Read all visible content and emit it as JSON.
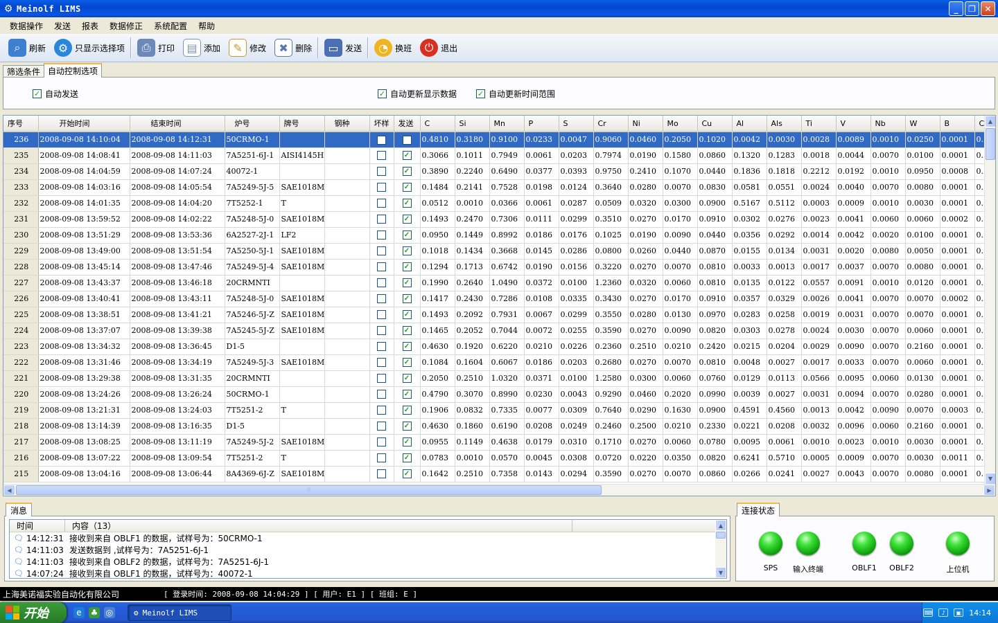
{
  "window": {
    "title": "Meinolf LIMS"
  },
  "menu": [
    "数据操作",
    "发送",
    "报表",
    "数据修正",
    "系统配置",
    "帮助"
  ],
  "toolbar": [
    {
      "label": "刷新",
      "icon": "magnifier-icon",
      "color": "#3f7fd0"
    },
    {
      "label": "只显示选择项",
      "icon": "gear-icon",
      "color": "#2a86d8"
    },
    {
      "label": "打印",
      "icon": "printer-icon",
      "color": "#6c8ab8"
    },
    {
      "label": "添加",
      "icon": "document-add-icon",
      "color": "#7a93c0"
    },
    {
      "label": "修改",
      "icon": "document-edit-icon",
      "color": "#c89a30"
    },
    {
      "label": "删除",
      "icon": "document-delete-icon",
      "color": "#5a78b0"
    },
    {
      "label": "发送",
      "icon": "send-icon",
      "color": "#4a6fb5"
    },
    {
      "label": "换班",
      "icon": "shift-icon",
      "color": "#f0b420"
    },
    {
      "label": "退出",
      "icon": "exit-icon",
      "color": "#d83020"
    }
  ],
  "tabs": [
    "筛选条件",
    "自动控制选项"
  ],
  "options": [
    {
      "label": "自动发送",
      "checked": true
    },
    {
      "label": "自动更新显示数据",
      "checked": true
    },
    {
      "label": "自动更新时间范围",
      "checked": true
    }
  ],
  "columns": [
    "序号",
    "开始时间",
    "结束时间",
    "炉号",
    "牌号",
    "钢种",
    "坏样",
    "发送",
    "C",
    "Si",
    "Mn",
    "P",
    "S",
    "Cr",
    "Ni",
    "Mo",
    "Cu",
    "Al",
    "Als",
    "Ti",
    "V",
    "Nb",
    "W",
    "B",
    "C"
  ],
  "rows": [
    {
      "id": "236",
      "start": "2008-09-08 14:10:04",
      "end": "2008-09-08 14:12:31",
      "heat": "50CRMO-1",
      "grade": "",
      "steel": "",
      "bad": false,
      "sent": false,
      "v": [
        "0.4810",
        "0.3180",
        "0.9100",
        "0.0233",
        "0.0047",
        "0.9060",
        "0.0460",
        "0.2050",
        "0.1020",
        "0.0042",
        "0.0030",
        "0.0028",
        "0.0089",
        "0.0010",
        "0.0250",
        "0.0001",
        "0."
      ],
      "sel": true
    },
    {
      "id": "235",
      "start": "2008-09-08 14:08:41",
      "end": "2008-09-08 14:11:03",
      "heat": "7A5251-6J-1",
      "grade": "AISI4145H",
      "steel": "",
      "bad": false,
      "sent": true,
      "v": [
        "0.3066",
        "0.1011",
        "0.7949",
        "0.0061",
        "0.0203",
        "0.7974",
        "0.0190",
        "0.1580",
        "0.0860",
        "0.1320",
        "0.1283",
        "0.0018",
        "0.0044",
        "0.0070",
        "0.0100",
        "0.0001",
        "0."
      ]
    },
    {
      "id": "234",
      "start": "2008-09-08 14:04:59",
      "end": "2008-09-08 14:07:24",
      "heat": "40072-1",
      "grade": "",
      "steel": "",
      "bad": false,
      "sent": true,
      "v": [
        "0.3890",
        "0.2240",
        "0.6490",
        "0.0377",
        "0.0393",
        "0.9750",
        "0.2410",
        "0.1070",
        "0.0440",
        "0.1836",
        "0.1818",
        "0.2212",
        "0.0192",
        "0.0010",
        "0.0950",
        "0.0008",
        "0."
      ]
    },
    {
      "id": "233",
      "start": "2008-09-08 14:03:16",
      "end": "2008-09-08 14:05:54",
      "heat": "7A5249-5J-5",
      "grade": "SAE1018M",
      "steel": "",
      "bad": false,
      "sent": true,
      "v": [
        "0.1484",
        "0.2141",
        "0.7528",
        "0.0198",
        "0.0124",
        "0.3640",
        "0.0280",
        "0.0070",
        "0.0830",
        "0.0581",
        "0.0551",
        "0.0024",
        "0.0040",
        "0.0070",
        "0.0080",
        "0.0001",
        "0."
      ]
    },
    {
      "id": "232",
      "start": "2008-09-08 14:01:35",
      "end": "2008-09-08 14:04:20",
      "heat": "7T5252-1",
      "grade": "T",
      "steel": "",
      "bad": false,
      "sent": true,
      "v": [
        "0.0512",
        "0.0010",
        "0.0366",
        "0.0061",
        "0.0287",
        "0.0509",
        "0.0320",
        "0.0300",
        "0.0900",
        "0.5167",
        "0.5112",
        "0.0003",
        "0.0009",
        "0.0010",
        "0.0030",
        "0.0001",
        "0."
      ]
    },
    {
      "id": "231",
      "start": "2008-09-08 13:59:52",
      "end": "2008-09-08 14:02:22",
      "heat": "7A5248-5J-0",
      "grade": "SAE1018M",
      "steel": "",
      "bad": false,
      "sent": true,
      "v": [
        "0.1493",
        "0.2470",
        "0.7306",
        "0.0111",
        "0.0299",
        "0.3510",
        "0.0270",
        "0.0170",
        "0.0910",
        "0.0302",
        "0.0276",
        "0.0023",
        "0.0041",
        "0.0060",
        "0.0060",
        "0.0002",
        "0."
      ]
    },
    {
      "id": "230",
      "start": "2008-09-08 13:51:29",
      "end": "2008-09-08 13:53:36",
      "heat": "6A2527-2J-1",
      "grade": "LF2",
      "steel": "",
      "bad": false,
      "sent": true,
      "v": [
        "0.0950",
        "0.1449",
        "0.8992",
        "0.0186",
        "0.0176",
        "0.1025",
        "0.0190",
        "0.0090",
        "0.0440",
        "0.0356",
        "0.0292",
        "0.0014",
        "0.0042",
        "0.0020",
        "0.0100",
        "0.0001",
        "0."
      ]
    },
    {
      "id": "229",
      "start": "2008-09-08 13:49:00",
      "end": "2008-09-08 13:51:54",
      "heat": "7A5250-5J-1",
      "grade": "SAE1018M",
      "steel": "",
      "bad": false,
      "sent": true,
      "v": [
        "0.1018",
        "0.1434",
        "0.3668",
        "0.0145",
        "0.0286",
        "0.0800",
        "0.0260",
        "0.0440",
        "0.0870",
        "0.0155",
        "0.0134",
        "0.0031",
        "0.0020",
        "0.0080",
        "0.0050",
        "0.0001",
        "0."
      ]
    },
    {
      "id": "228",
      "start": "2008-09-08 13:45:14",
      "end": "2008-09-08 13:47:46",
      "heat": "7A5249-5J-4",
      "grade": "SAE1018M",
      "steel": "",
      "bad": false,
      "sent": true,
      "v": [
        "0.1294",
        "0.1713",
        "0.6742",
        "0.0190",
        "0.0156",
        "0.3220",
        "0.0270",
        "0.0070",
        "0.0810",
        "0.0033",
        "0.0013",
        "0.0017",
        "0.0037",
        "0.0070",
        "0.0080",
        "0.0001",
        "0."
      ]
    },
    {
      "id": "227",
      "start": "2008-09-08 13:43:37",
      "end": "2008-09-08 13:46:18",
      "heat": "20CRMNTI",
      "grade": "",
      "steel": "",
      "bad": false,
      "sent": true,
      "v": [
        "0.1990",
        "0.2640",
        "1.0490",
        "0.0372",
        "0.0100",
        "1.2360",
        "0.0320",
        "0.0060",
        "0.0810",
        "0.0135",
        "0.0122",
        "0.0557",
        "0.0091",
        "0.0010",
        "0.0120",
        "0.0001",
        "0."
      ]
    },
    {
      "id": "226",
      "start": "2008-09-08 13:40:41",
      "end": "2008-09-08 13:43:11",
      "heat": "7A5248-5J-0",
      "grade": "SAE1018M",
      "steel": "",
      "bad": false,
      "sent": true,
      "v": [
        "0.1417",
        "0.2430",
        "0.7286",
        "0.0108",
        "0.0335",
        "0.3430",
        "0.0270",
        "0.0170",
        "0.0910",
        "0.0357",
        "0.0329",
        "0.0026",
        "0.0041",
        "0.0070",
        "0.0070",
        "0.0002",
        "0."
      ]
    },
    {
      "id": "225",
      "start": "2008-09-08 13:38:51",
      "end": "2008-09-08 13:41:21",
      "heat": "7A5246-5J-Z",
      "grade": "SAE1018M",
      "steel": "",
      "bad": false,
      "sent": true,
      "v": [
        "0.1493",
        "0.2092",
        "0.7931",
        "0.0067",
        "0.0299",
        "0.3550",
        "0.0280",
        "0.0130",
        "0.0970",
        "0.0283",
        "0.0258",
        "0.0019",
        "0.0031",
        "0.0070",
        "0.0070",
        "0.0001",
        "0."
      ]
    },
    {
      "id": "224",
      "start": "2008-09-08 13:37:07",
      "end": "2008-09-08 13:39:38",
      "heat": "7A5245-5J-Z",
      "grade": "SAE1018M",
      "steel": "",
      "bad": false,
      "sent": true,
      "v": [
        "0.1465",
        "0.2052",
        "0.7044",
        "0.0072",
        "0.0255",
        "0.3590",
        "0.0270",
        "0.0090",
        "0.0820",
        "0.0303",
        "0.0278",
        "0.0024",
        "0.0030",
        "0.0070",
        "0.0060",
        "0.0001",
        "0."
      ]
    },
    {
      "id": "223",
      "start": "2008-09-08 13:34:32",
      "end": "2008-09-08 13:36:45",
      "heat": "D1-5",
      "grade": "",
      "steel": "",
      "bad": false,
      "sent": true,
      "v": [
        "0.4630",
        "0.1920",
        "0.6220",
        "0.0210",
        "0.0226",
        "0.2360",
        "0.2510",
        "0.0210",
        "0.2420",
        "0.0215",
        "0.0204",
        "0.0029",
        "0.0090",
        "0.0070",
        "0.2160",
        "0.0001",
        "0."
      ]
    },
    {
      "id": "222",
      "start": "2008-09-08 13:31:46",
      "end": "2008-09-08 13:34:19",
      "heat": "7A5249-5J-3",
      "grade": "SAE1018M",
      "steel": "",
      "bad": false,
      "sent": true,
      "v": [
        "0.1084",
        "0.1604",
        "0.6067",
        "0.0186",
        "0.0203",
        "0.2680",
        "0.0270",
        "0.0070",
        "0.0810",
        "0.0048",
        "0.0027",
        "0.0017",
        "0.0033",
        "0.0070",
        "0.0060",
        "0.0001",
        "0."
      ]
    },
    {
      "id": "221",
      "start": "2008-09-08 13:29:38",
      "end": "2008-09-08 13:31:35",
      "heat": "20CRMNTI",
      "grade": "",
      "steel": "",
      "bad": false,
      "sent": true,
      "v": [
        "0.2050",
        "0.2510",
        "1.0320",
        "0.0371",
        "0.0100",
        "1.2580",
        "0.0300",
        "0.0060",
        "0.0760",
        "0.0129",
        "0.0113",
        "0.0566",
        "0.0095",
        "0.0060",
        "0.0130",
        "0.0001",
        "0."
      ]
    },
    {
      "id": "220",
      "start": "2008-09-08 13:24:26",
      "end": "2008-09-08 13:26:24",
      "heat": "50CRMO-1",
      "grade": "",
      "steel": "",
      "bad": false,
      "sent": true,
      "v": [
        "0.4790",
        "0.3070",
        "0.8990",
        "0.0230",
        "0.0043",
        "0.9290",
        "0.0460",
        "0.2020",
        "0.0990",
        "0.0039",
        "0.0027",
        "0.0031",
        "0.0094",
        "0.0070",
        "0.0280",
        "0.0001",
        "0."
      ]
    },
    {
      "id": "219",
      "start": "2008-09-08 13:21:31",
      "end": "2008-09-08 13:24:03",
      "heat": "7T5251-2",
      "grade": "T",
      "steel": "",
      "bad": false,
      "sent": true,
      "v": [
        "0.1906",
        "0.0832",
        "0.7335",
        "0.0077",
        "0.0309",
        "0.7640",
        "0.0290",
        "0.1630",
        "0.0900",
        "0.4591",
        "0.4560",
        "0.0013",
        "0.0042",
        "0.0090",
        "0.0070",
        "0.0003",
        "0."
      ]
    },
    {
      "id": "218",
      "start": "2008-09-08 13:14:39",
      "end": "2008-09-08 13:16:35",
      "heat": "D1-5",
      "grade": "",
      "steel": "",
      "bad": false,
      "sent": true,
      "v": [
        "0.4630",
        "0.1860",
        "0.6190",
        "0.0208",
        "0.0249",
        "0.2460",
        "0.2500",
        "0.0210",
        "0.2330",
        "0.0221",
        "0.0208",
        "0.0032",
        "0.0096",
        "0.0060",
        "0.2160",
        "0.0001",
        "0."
      ]
    },
    {
      "id": "217",
      "start": "2008-09-08 13:08:25",
      "end": "2008-09-08 13:11:19",
      "heat": "7A5249-5J-2",
      "grade": "SAE1018M",
      "steel": "",
      "bad": false,
      "sent": true,
      "v": [
        "0.0955",
        "0.1149",
        "0.4638",
        "0.0179",
        "0.0310",
        "0.1710",
        "0.0270",
        "0.0060",
        "0.0780",
        "0.0095",
        "0.0061",
        "0.0010",
        "0.0023",
        "0.0010",
        "0.0030",
        "0.0001",
        "0."
      ]
    },
    {
      "id": "216",
      "start": "2008-09-08 13:07:22",
      "end": "2008-09-08 13:09:54",
      "heat": "7T5251-2",
      "grade": "T",
      "steel": "",
      "bad": false,
      "sent": true,
      "v": [
        "0.0783",
        "0.0010",
        "0.0570",
        "0.0045",
        "0.0308",
        "0.0720",
        "0.0220",
        "0.0350",
        "0.0820",
        "0.6241",
        "0.5710",
        "0.0005",
        "0.0009",
        "0.0070",
        "0.0030",
        "0.0011",
        "0."
      ]
    },
    {
      "id": "215",
      "start": "2008-09-08 13:04:16",
      "end": "2008-09-08 13:06:44",
      "heat": "8A4369-6J-Z",
      "grade": "SAE1018M",
      "steel": "",
      "bad": false,
      "sent": true,
      "v": [
        "0.1642",
        "0.2510",
        "0.7358",
        "0.0143",
        "0.0294",
        "0.3590",
        "0.0270",
        "0.0070",
        "0.0860",
        "0.0266",
        "0.0241",
        "0.0027",
        "0.0043",
        "0.0070",
        "0.0080",
        "0.0001",
        "0."
      ]
    }
  ],
  "messages": {
    "tab": "消息",
    "col_time": "时间",
    "col_content": "内容（13）",
    "rows": [
      {
        "time": "14:12:31",
        "text": "接收到来自 OBLF1 的数据，试样号为：50CRMO-1"
      },
      {
        "time": "14:11:03",
        "text": "发送数据到 ,试样号为：7A5251-6J-1"
      },
      {
        "time": "14:11:03",
        "text": "接收到来自 OBLF2 的数据，试样号为：7A5251-6J-1"
      },
      {
        "time": "14:07:24",
        "text": "接收到来自 OBLF1 的数据，试样号为：40072-1"
      }
    ]
  },
  "connection": {
    "tab": "连接状态",
    "items": [
      "SPS",
      "输入终端",
      "OBLF1",
      "OBLF2",
      "上位机"
    ],
    "color": "#22c41e"
  },
  "status": {
    "company": "上海美诺福实验自动化有限公司",
    "info": "[ 登录时间: 2008-09-08 14:04:29 ] [ 用户: E1 ] [ 班组: E ]"
  },
  "taskbar": {
    "start": "开始",
    "task": "Meinolf LIMS",
    "clock": "14:14"
  }
}
